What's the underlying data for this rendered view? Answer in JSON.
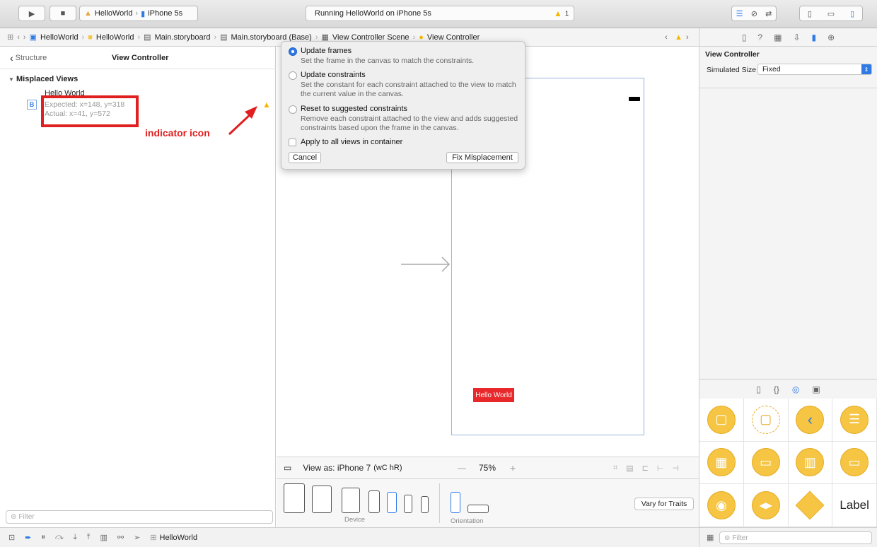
{
  "toolbar": {
    "scheme_app": "HelloWorld",
    "scheme_device": "iPhone 5s",
    "status_text": "Running HelloWorld on iPhone 5s",
    "warning_count": "1"
  },
  "jumpbar": {
    "items": [
      "HelloWorld",
      "HelloWorld",
      "Main.storyboard",
      "Main.storyboard (Base)",
      "View Controller Scene",
      "View Controller"
    ]
  },
  "outline": {
    "back_label": "Structure",
    "title": "View Controller",
    "section": "Misplaced Views",
    "view_name": "Hello World",
    "badge": "B",
    "expected": "Expected: x=148, y=318",
    "actual": "Actual: x=41, y=572"
  },
  "annotation": {
    "text": "indicator icon",
    "color": "#e02020"
  },
  "popover": {
    "options": [
      {
        "title": "Update frames",
        "desc": "Set the frame in the canvas to match the constraints."
      },
      {
        "title": "Update constraints",
        "desc": "Set the constant for each constraint attached to the view to match the current value in the canvas."
      },
      {
        "title": "Reset to suggested constraints",
        "desc": "Remove each constraint attached to the view and adds suggested constraints based upon the frame in the canvas."
      }
    ],
    "checkbox_label": "Apply to all views in container",
    "cancel": "Cancel",
    "fix": "Fix Misplacement"
  },
  "canvas": {
    "label_text": "Hello World",
    "label_color": "#e8282a"
  },
  "view_as": {
    "label": "View as: iPhone 7",
    "traits": "(wC hR)",
    "zoom": "75%",
    "zoom_minus": "—",
    "zoom_plus": "+",
    "device_caption": "Device",
    "orientation_caption": "Orientation",
    "vary_button": "Vary for Traits"
  },
  "filter": {
    "placeholder_left": "Filter",
    "placeholder_right": "Filter"
  },
  "bottom_bar": {
    "target": "HelloWorld"
  },
  "inspector": {
    "title": "View Controller",
    "simulated_size_label": "Simulated Size",
    "simulated_size_value": "Fixed"
  },
  "library": {
    "label_item": "Label"
  },
  "colors": {
    "accent": "#2f7ae5",
    "warning": "#f5b800",
    "library_yellow": "#f5c543"
  }
}
